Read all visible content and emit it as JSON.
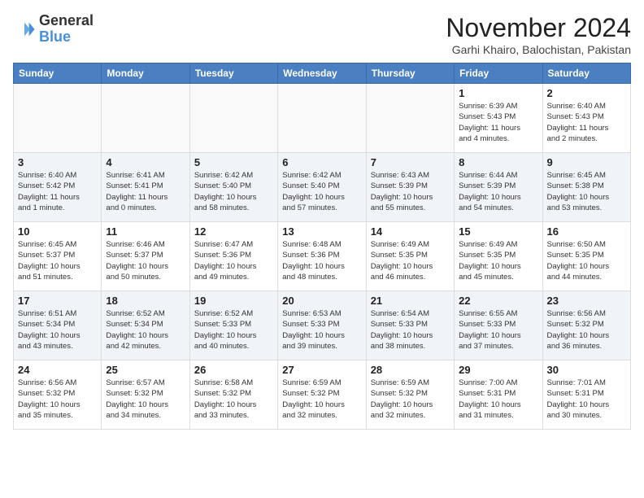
{
  "header": {
    "logo_line1": "General",
    "logo_line2": "Blue",
    "month_title": "November 2024",
    "subtitle": "Garhi Khairo, Balochistan, Pakistan"
  },
  "days_of_week": [
    "Sunday",
    "Monday",
    "Tuesday",
    "Wednesday",
    "Thursday",
    "Friday",
    "Saturday"
  ],
  "weeks": [
    {
      "id": "week1",
      "cells": [
        {
          "day": "",
          "info": ""
        },
        {
          "day": "",
          "info": ""
        },
        {
          "day": "",
          "info": ""
        },
        {
          "day": "",
          "info": ""
        },
        {
          "day": "",
          "info": ""
        },
        {
          "day": "1",
          "info": "Sunrise: 6:39 AM\nSunset: 5:43 PM\nDaylight: 11 hours\nand 4 minutes."
        },
        {
          "day": "2",
          "info": "Sunrise: 6:40 AM\nSunset: 5:43 PM\nDaylight: 11 hours\nand 2 minutes."
        }
      ]
    },
    {
      "id": "week2",
      "cells": [
        {
          "day": "3",
          "info": "Sunrise: 6:40 AM\nSunset: 5:42 PM\nDaylight: 11 hours\nand 1 minute."
        },
        {
          "day": "4",
          "info": "Sunrise: 6:41 AM\nSunset: 5:41 PM\nDaylight: 11 hours\nand 0 minutes."
        },
        {
          "day": "5",
          "info": "Sunrise: 6:42 AM\nSunset: 5:40 PM\nDaylight: 10 hours\nand 58 minutes."
        },
        {
          "day": "6",
          "info": "Sunrise: 6:42 AM\nSunset: 5:40 PM\nDaylight: 10 hours\nand 57 minutes."
        },
        {
          "day": "7",
          "info": "Sunrise: 6:43 AM\nSunset: 5:39 PM\nDaylight: 10 hours\nand 55 minutes."
        },
        {
          "day": "8",
          "info": "Sunrise: 6:44 AM\nSunset: 5:39 PM\nDaylight: 10 hours\nand 54 minutes."
        },
        {
          "day": "9",
          "info": "Sunrise: 6:45 AM\nSunset: 5:38 PM\nDaylight: 10 hours\nand 53 minutes."
        }
      ]
    },
    {
      "id": "week3",
      "cells": [
        {
          "day": "10",
          "info": "Sunrise: 6:45 AM\nSunset: 5:37 PM\nDaylight: 10 hours\nand 51 minutes."
        },
        {
          "day": "11",
          "info": "Sunrise: 6:46 AM\nSunset: 5:37 PM\nDaylight: 10 hours\nand 50 minutes."
        },
        {
          "day": "12",
          "info": "Sunrise: 6:47 AM\nSunset: 5:36 PM\nDaylight: 10 hours\nand 49 minutes."
        },
        {
          "day": "13",
          "info": "Sunrise: 6:48 AM\nSunset: 5:36 PM\nDaylight: 10 hours\nand 48 minutes."
        },
        {
          "day": "14",
          "info": "Sunrise: 6:49 AM\nSunset: 5:35 PM\nDaylight: 10 hours\nand 46 minutes."
        },
        {
          "day": "15",
          "info": "Sunrise: 6:49 AM\nSunset: 5:35 PM\nDaylight: 10 hours\nand 45 minutes."
        },
        {
          "day": "16",
          "info": "Sunrise: 6:50 AM\nSunset: 5:35 PM\nDaylight: 10 hours\nand 44 minutes."
        }
      ]
    },
    {
      "id": "week4",
      "cells": [
        {
          "day": "17",
          "info": "Sunrise: 6:51 AM\nSunset: 5:34 PM\nDaylight: 10 hours\nand 43 minutes."
        },
        {
          "day": "18",
          "info": "Sunrise: 6:52 AM\nSunset: 5:34 PM\nDaylight: 10 hours\nand 42 minutes."
        },
        {
          "day": "19",
          "info": "Sunrise: 6:52 AM\nSunset: 5:33 PM\nDaylight: 10 hours\nand 40 minutes."
        },
        {
          "day": "20",
          "info": "Sunrise: 6:53 AM\nSunset: 5:33 PM\nDaylight: 10 hours\nand 39 minutes."
        },
        {
          "day": "21",
          "info": "Sunrise: 6:54 AM\nSunset: 5:33 PM\nDaylight: 10 hours\nand 38 minutes."
        },
        {
          "day": "22",
          "info": "Sunrise: 6:55 AM\nSunset: 5:33 PM\nDaylight: 10 hours\nand 37 minutes."
        },
        {
          "day": "23",
          "info": "Sunrise: 6:56 AM\nSunset: 5:32 PM\nDaylight: 10 hours\nand 36 minutes."
        }
      ]
    },
    {
      "id": "week5",
      "cells": [
        {
          "day": "24",
          "info": "Sunrise: 6:56 AM\nSunset: 5:32 PM\nDaylight: 10 hours\nand 35 minutes."
        },
        {
          "day": "25",
          "info": "Sunrise: 6:57 AM\nSunset: 5:32 PM\nDaylight: 10 hours\nand 34 minutes."
        },
        {
          "day": "26",
          "info": "Sunrise: 6:58 AM\nSunset: 5:32 PM\nDaylight: 10 hours\nand 33 minutes."
        },
        {
          "day": "27",
          "info": "Sunrise: 6:59 AM\nSunset: 5:32 PM\nDaylight: 10 hours\nand 32 minutes."
        },
        {
          "day": "28",
          "info": "Sunrise: 6:59 AM\nSunset: 5:32 PM\nDaylight: 10 hours\nand 32 minutes."
        },
        {
          "day": "29",
          "info": "Sunrise: 7:00 AM\nSunset: 5:31 PM\nDaylight: 10 hours\nand 31 minutes."
        },
        {
          "day": "30",
          "info": "Sunrise: 7:01 AM\nSunset: 5:31 PM\nDaylight: 10 hours\nand 30 minutes."
        }
      ]
    }
  ]
}
